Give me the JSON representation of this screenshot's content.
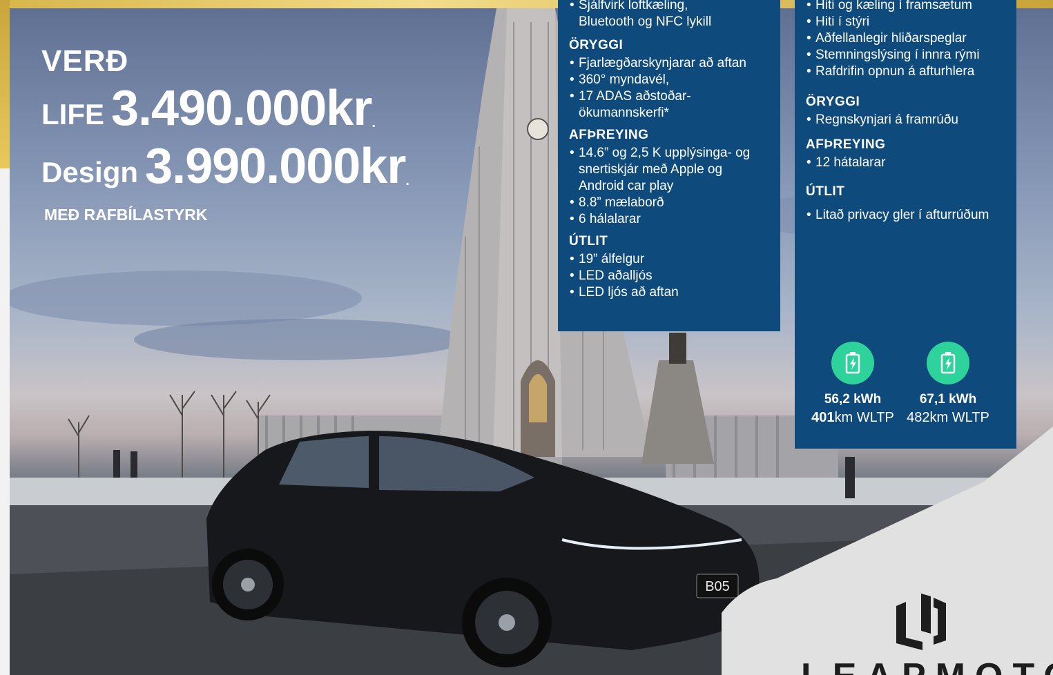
{
  "pricing": {
    "heading": "VERÐ",
    "trims": [
      {
        "label": "LIFE",
        "price": "3.490.000kr",
        "suffix": "."
      },
      {
        "label": "Design",
        "price": "3.990.000kr",
        "suffix": "."
      }
    ],
    "subsidy_note": "MEÐ RAFBÍLASTYRK"
  },
  "panel_life": {
    "sections": [
      {
        "heading": "",
        "items": [
          "Sjálfvirk loftkæling,\nBluetooth og NFC lykill"
        ]
      },
      {
        "heading": "ÖRYGGI",
        "items": [
          "Fjarlægðarskynjarar að aftan",
          "360° myndavél,",
          "17 ADAS aðstoðar-\nökumannskerfi*"
        ]
      },
      {
        "heading": "AFÞREYING",
        "items": [
          "14.6” og 2,5 K upplýsinga- og snertiskjár með Apple og Android car play",
          "8.8” mælaborð",
          "6 hálalarar"
        ]
      },
      {
        "heading": "ÚTLIT",
        "items": [
          "19” álfelgur",
          "LED aðalljós",
          "LED ljós að aftan"
        ]
      }
    ]
  },
  "panel_design": {
    "sections": [
      {
        "heading": "",
        "items": [
          "Hiti og kæling í framsætum",
          "Hiti í stýri",
          "Aðfellanlegir hliðarspeglar",
          "Stemningslýsing í innra rými",
          "Rafdrifin opnun á afturhlera"
        ]
      },
      {
        "heading": "ÖRYGGI",
        "items": [
          "Regnskynjari á framrúðu"
        ]
      },
      {
        "heading": "AFÞREYING",
        "items": [
          "12 hátalarar"
        ]
      },
      {
        "heading": "ÚTLIT",
        "items": [
          "Litað privacy gler í afturrúðum"
        ]
      }
    ],
    "batteries": [
      {
        "icon": "battery-charging-icon",
        "kwh": "56,2 kWh",
        "range_bold": "401",
        "range_rest": "km WLTP"
      },
      {
        "icon": "battery-charging-icon",
        "kwh": "67,1 kWh",
        "range_bold": "",
        "range_rest": "482km WLTP"
      }
    ]
  },
  "car": {
    "plate": "B05"
  },
  "brand": {
    "name": "LEAPMOTOR",
    "logo_icon": "leapmotor-logo-icon"
  },
  "colors": {
    "panel": "#0e4a7c",
    "accent_green": "#2ed39c",
    "gold": "#d8b64b"
  }
}
